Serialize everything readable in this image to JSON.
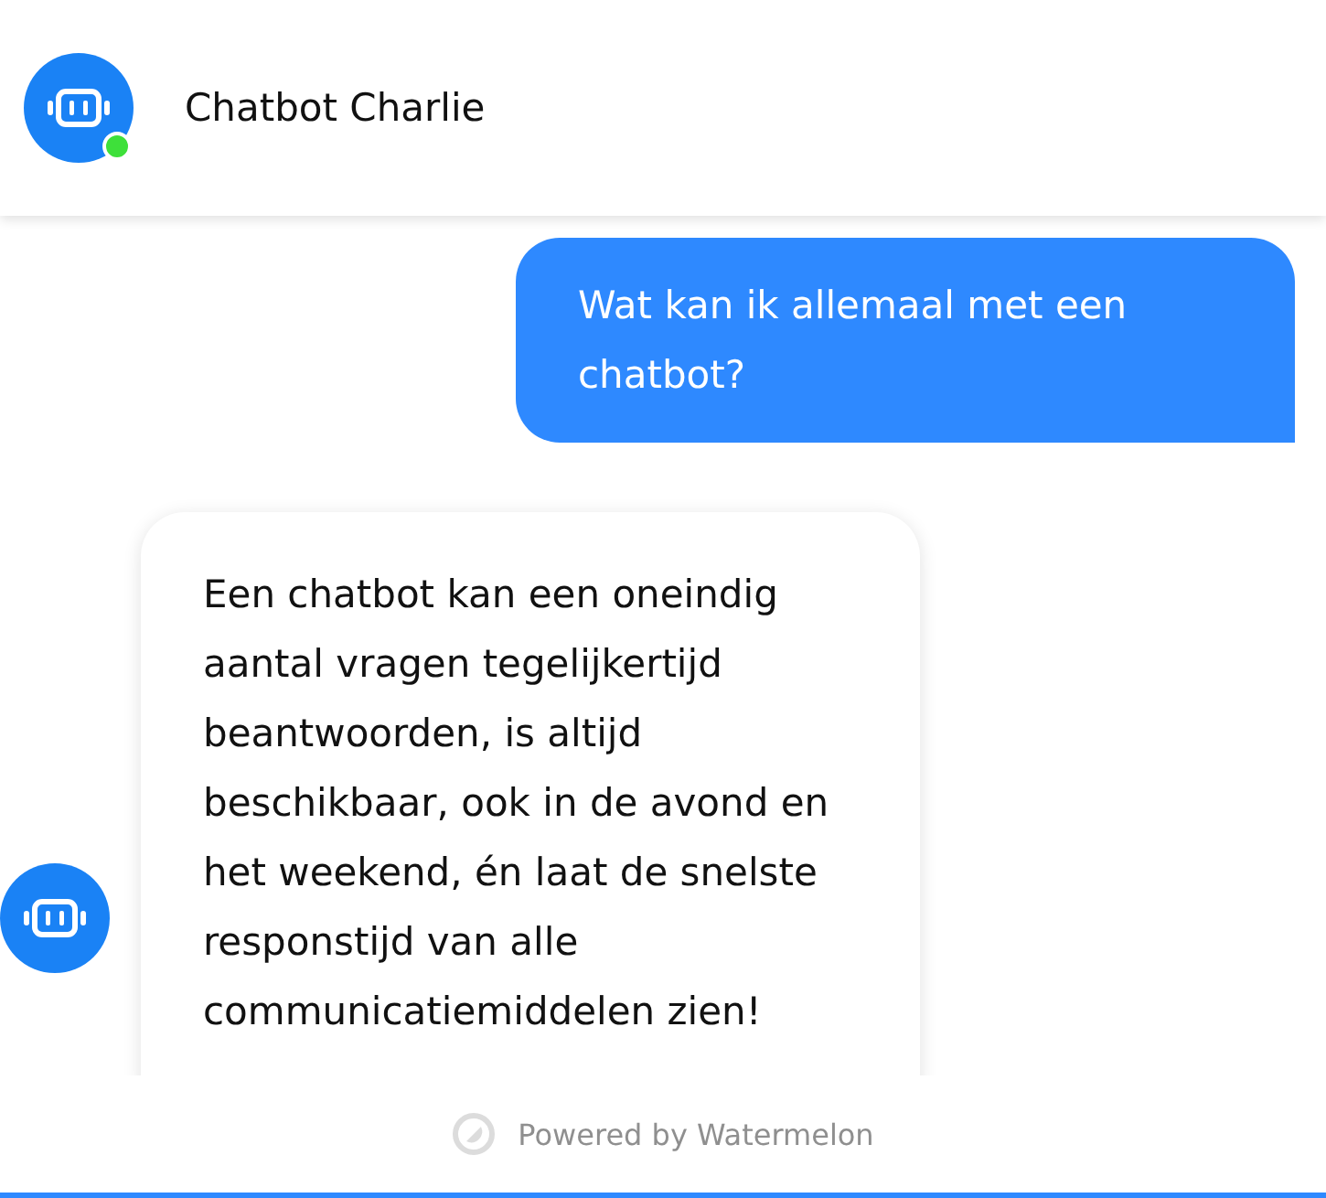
{
  "header": {
    "title": "Chatbot Charlie",
    "online": true
  },
  "messages": [
    {
      "kind": "user",
      "text": "Wat kan ik allemaal met een chatbot?"
    },
    {
      "kind": "bot",
      "text": "Een chatbot kan een oneindig aantal vragen tegelijkertijd beantwoorden, is altijd beschikbaar, ook in de avond en het weekend, én laat de snelste responstijd van alle communicatiemiddelen zien!"
    }
  ],
  "footer": {
    "text": "Powered by Watermelon"
  }
}
